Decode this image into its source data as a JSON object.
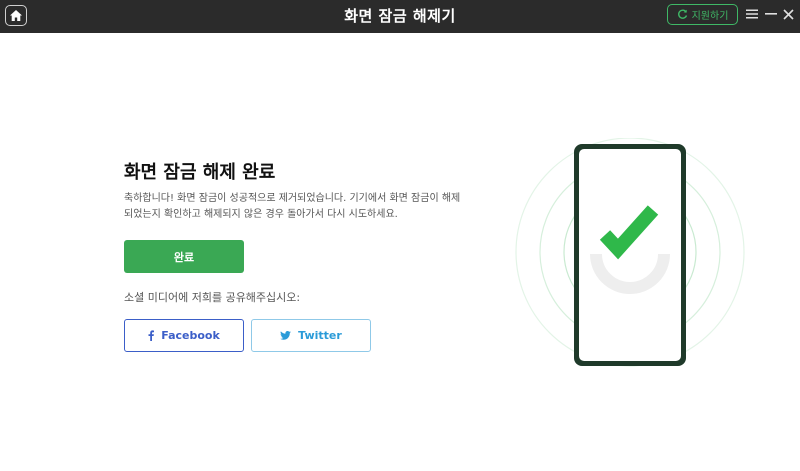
{
  "app": {
    "title": "화면 잠금 해제기",
    "support_label": "지원하기"
  },
  "main": {
    "heading": "화면 잠금 해제 완료",
    "description": "축하합니다! 화면 잠금이 성공적으로 제거되었습니다. 기기에서 화면 잠금이 해제되었는지 확인하고 해제되지 않은 경우 돌아가서 다시 시도하세요.",
    "done_label": "완료",
    "share_prompt": "소셜 미디어에 저희를 공유해주십시오:",
    "facebook_label": "Facebook",
    "twitter_label": "Twitter"
  },
  "colors": {
    "titlebar_bg": "#2b2b2b",
    "accent_green": "#3aa854",
    "facebook_blue": "#3b5ec8",
    "twitter_blue": "#2b9bd8",
    "check_green": "#2fb84a"
  },
  "icons": [
    "home-icon",
    "refresh-icon",
    "menu-icon",
    "minimize-icon",
    "close-icon",
    "facebook-icon",
    "twitter-icon",
    "checkmark-icon"
  ]
}
